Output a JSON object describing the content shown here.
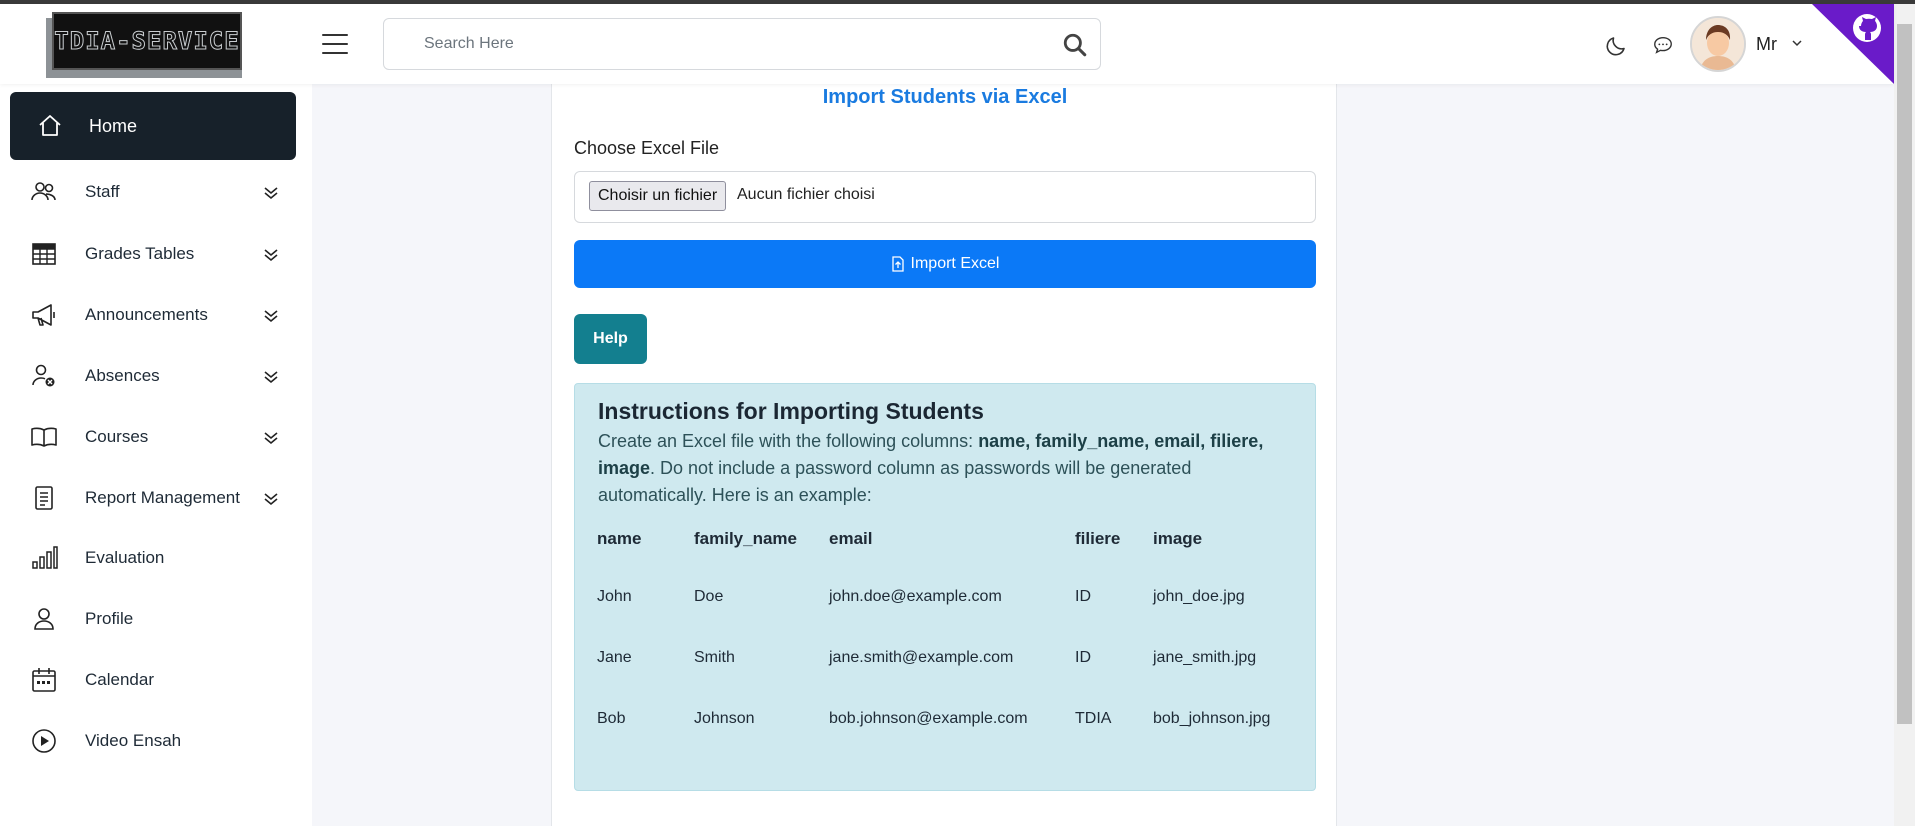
{
  "app": {
    "logo_text": "TDIA-SERVICE"
  },
  "header": {
    "search_placeholder": "Search Here",
    "user_name": "Mr"
  },
  "sidebar": {
    "items": [
      {
        "label": "Home",
        "icon": "home-icon",
        "active": true
      },
      {
        "label": "Staff",
        "icon": "users-icon",
        "expandable": true
      },
      {
        "label": "Grades Tables",
        "icon": "table-icon",
        "expandable": true
      },
      {
        "label": "Announcements",
        "icon": "megaphone-icon",
        "expandable": true
      },
      {
        "label": "Absences",
        "icon": "user-x-icon",
        "expandable": true
      },
      {
        "label": "Courses",
        "icon": "book-icon",
        "expandable": true
      },
      {
        "label": "Report Management",
        "icon": "document-icon",
        "expandable": true
      },
      {
        "label": "Evaluation",
        "icon": "bar-chart-icon"
      },
      {
        "label": "Profile",
        "icon": "user-icon"
      },
      {
        "label": "Calendar",
        "icon": "calendar-icon"
      },
      {
        "label": "Video Ensah",
        "icon": "play-circle-icon"
      }
    ]
  },
  "main": {
    "title": "Import Students via Excel",
    "file_label": "Choose Excel File",
    "file_button": "Choisir un fichier",
    "file_status": "Aucun fichier choisi",
    "import_button": "Import Excel",
    "help_button": "Help",
    "instructions": {
      "title": "Instructions for Importing Students",
      "desc_prefix": "Create an Excel file with the following columns: ",
      "desc_columns": "name, family_name, email, filiere, image",
      "desc_suffix": ". Do not include a password column as passwords will be generated automatically. Here is an example:",
      "table": {
        "headers": [
          "name",
          "family_name",
          "email",
          "filiere",
          "image"
        ],
        "rows": [
          [
            "John",
            "Doe",
            "john.doe@example.com",
            "ID",
            "john_doe.jpg"
          ],
          [
            "Jane",
            "Smith",
            "jane.smith@example.com",
            "ID",
            "jane_smith.jpg"
          ],
          [
            "Bob",
            "Johnson",
            "bob.johnson@example.com",
            "TDIA",
            "bob_johnson.jpg"
          ]
        ]
      }
    }
  },
  "colors": {
    "primary": "#0b79f7",
    "help": "#137f8f",
    "sidebar_active": "#17212a",
    "info_bg": "#cfe9ef",
    "title": "#1a7be0",
    "corner": "#6a1bc9"
  }
}
